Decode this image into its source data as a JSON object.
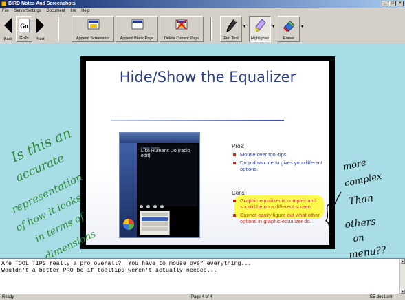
{
  "window": {
    "title": "BIRD Notes And Screenshots",
    "controls": [
      "_",
      "□",
      "×"
    ]
  },
  "menu": [
    "File",
    "ServerSettings",
    "Document",
    "Ink",
    "Help"
  ],
  "toolbar": {
    "back": "Back",
    "goto_box": "Go",
    "goto": "GoTo",
    "next": "Next",
    "append_screenshot": "Append Screenshot",
    "append_blank": "Append Blank Page",
    "delete_page": "Delete Current Page",
    "pen_tool": "Pen Tool",
    "highlighter": "Highlighter",
    "eraser": "Eraser",
    "dropdown": "▾"
  },
  "slide": {
    "title": "Hide/Show the Equalizer",
    "pros_heading": "Pros:",
    "pros": [
      "Mouse over tool-tips",
      "Drop down menu gives you different options."
    ],
    "cons_heading": "Cons:",
    "cons": [
      "Graphic equalizer is complex and should be on a different screen.",
      "Cannot easily figure out what other options in graphic equalizer do."
    ],
    "player_small": "Classic Stories",
    "player_track": "Like Humans Do (radio edit)"
  },
  "annotations": {
    "green_ink": [
      "Is this an",
      "accurate",
      "representation",
      "of how it looks",
      "in terms of",
      "dimensions"
    ],
    "black_ink": [
      "more",
      "complex",
      "Than",
      "others",
      "on",
      "menu??"
    ],
    "green_color": "#2e8a3a",
    "black_color": "#111111",
    "highlight_color": "#fffa2d"
  },
  "notes": {
    "lines": [
      "Are TOOL TIPS really a pro overall?  You have to mouse over everything...",
      "Wouldn't a better PRO be if tooltips weren't actually needed..."
    ]
  },
  "status": {
    "left": "Ready",
    "center": "Page 4 of 4",
    "right": "EE doc1.snr"
  }
}
